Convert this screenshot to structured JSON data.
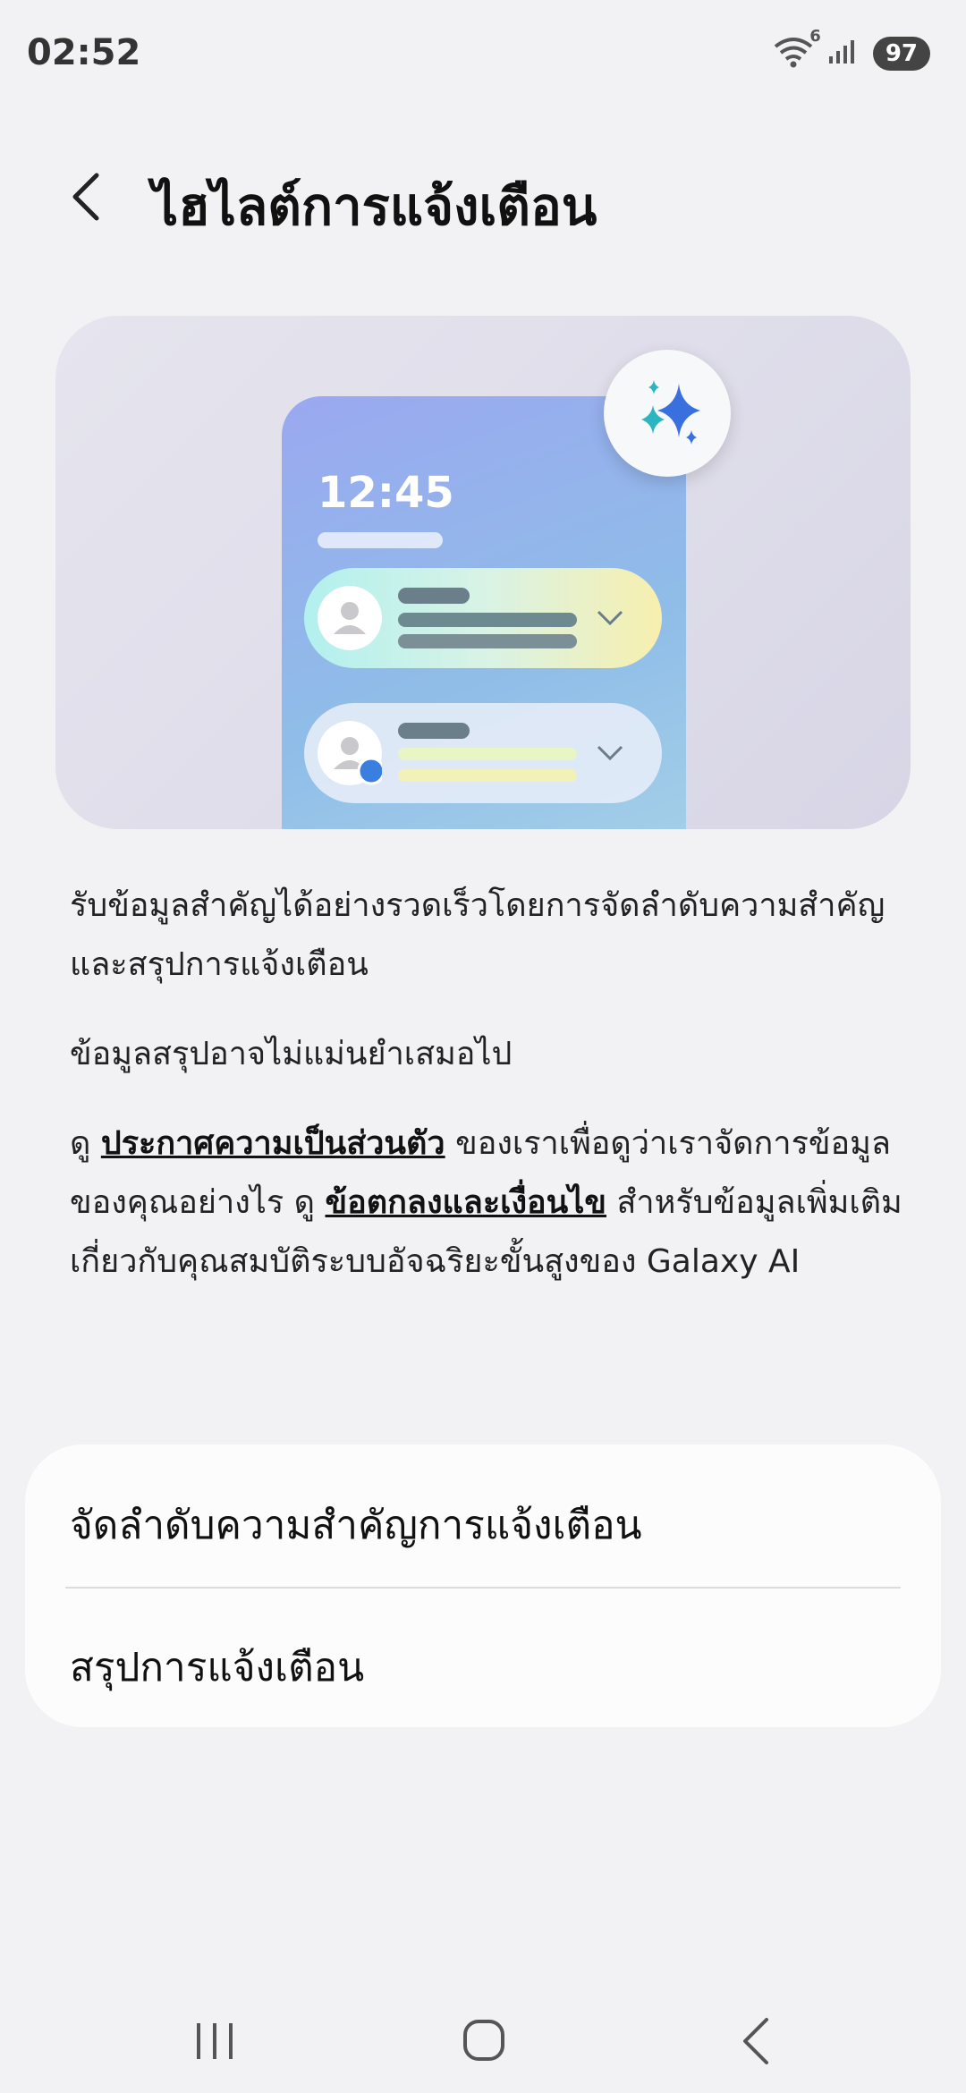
{
  "status_bar": {
    "time": "02:52",
    "wifi_badge": "6",
    "battery": "97",
    "icons": [
      "wifi-icon",
      "signal-icon",
      "battery-icon"
    ]
  },
  "header": {
    "title": "ไฮไลต์การแจ้งเตือน",
    "back_icon": "chevron-left-icon"
  },
  "illustration": {
    "clock": "12:45",
    "badge_icon": "sparkle-icon"
  },
  "description": {
    "p1": "รับข้อมูลสำคัญได้อย่างรวดเร็วโดยการจัดลำดับความสำคัญและสรุปการแจ้งเตือน",
    "p2": "ข้อมูลสรุปอาจไม่แม่นยำเสมอไป",
    "p3_prefix": "ดู",
    "privacy_link": "ประกาศความเป็นส่วนตัว",
    "p3_middle": "ของเราเพื่อดูว่าเราจัดการข้อมูลของคุณอย่างไร ดู",
    "terms_link": "ข้อตกลงและเงื่อนไข",
    "p3_suffix": "สำหรับข้อมูลเพิ่มเติมเกี่ยวกับคุณสมบัติระบบอัจฉริยะขั้นสูงของ Galaxy AI"
  },
  "settings": {
    "items": [
      {
        "label": "จัดลำดับความสำคัญการแจ้งเตือน"
      },
      {
        "label": "สรุปการแจ้งเตือน"
      }
    ]
  },
  "nav_bar": {
    "icons": [
      "recents-icon",
      "home-icon",
      "back-icon"
    ]
  },
  "colors": {
    "background": "#f2f2f4",
    "card": "#fcfcfd",
    "sparkle_blue": "#3a6fe0",
    "sparkle_teal": "#2bb5c0"
  }
}
